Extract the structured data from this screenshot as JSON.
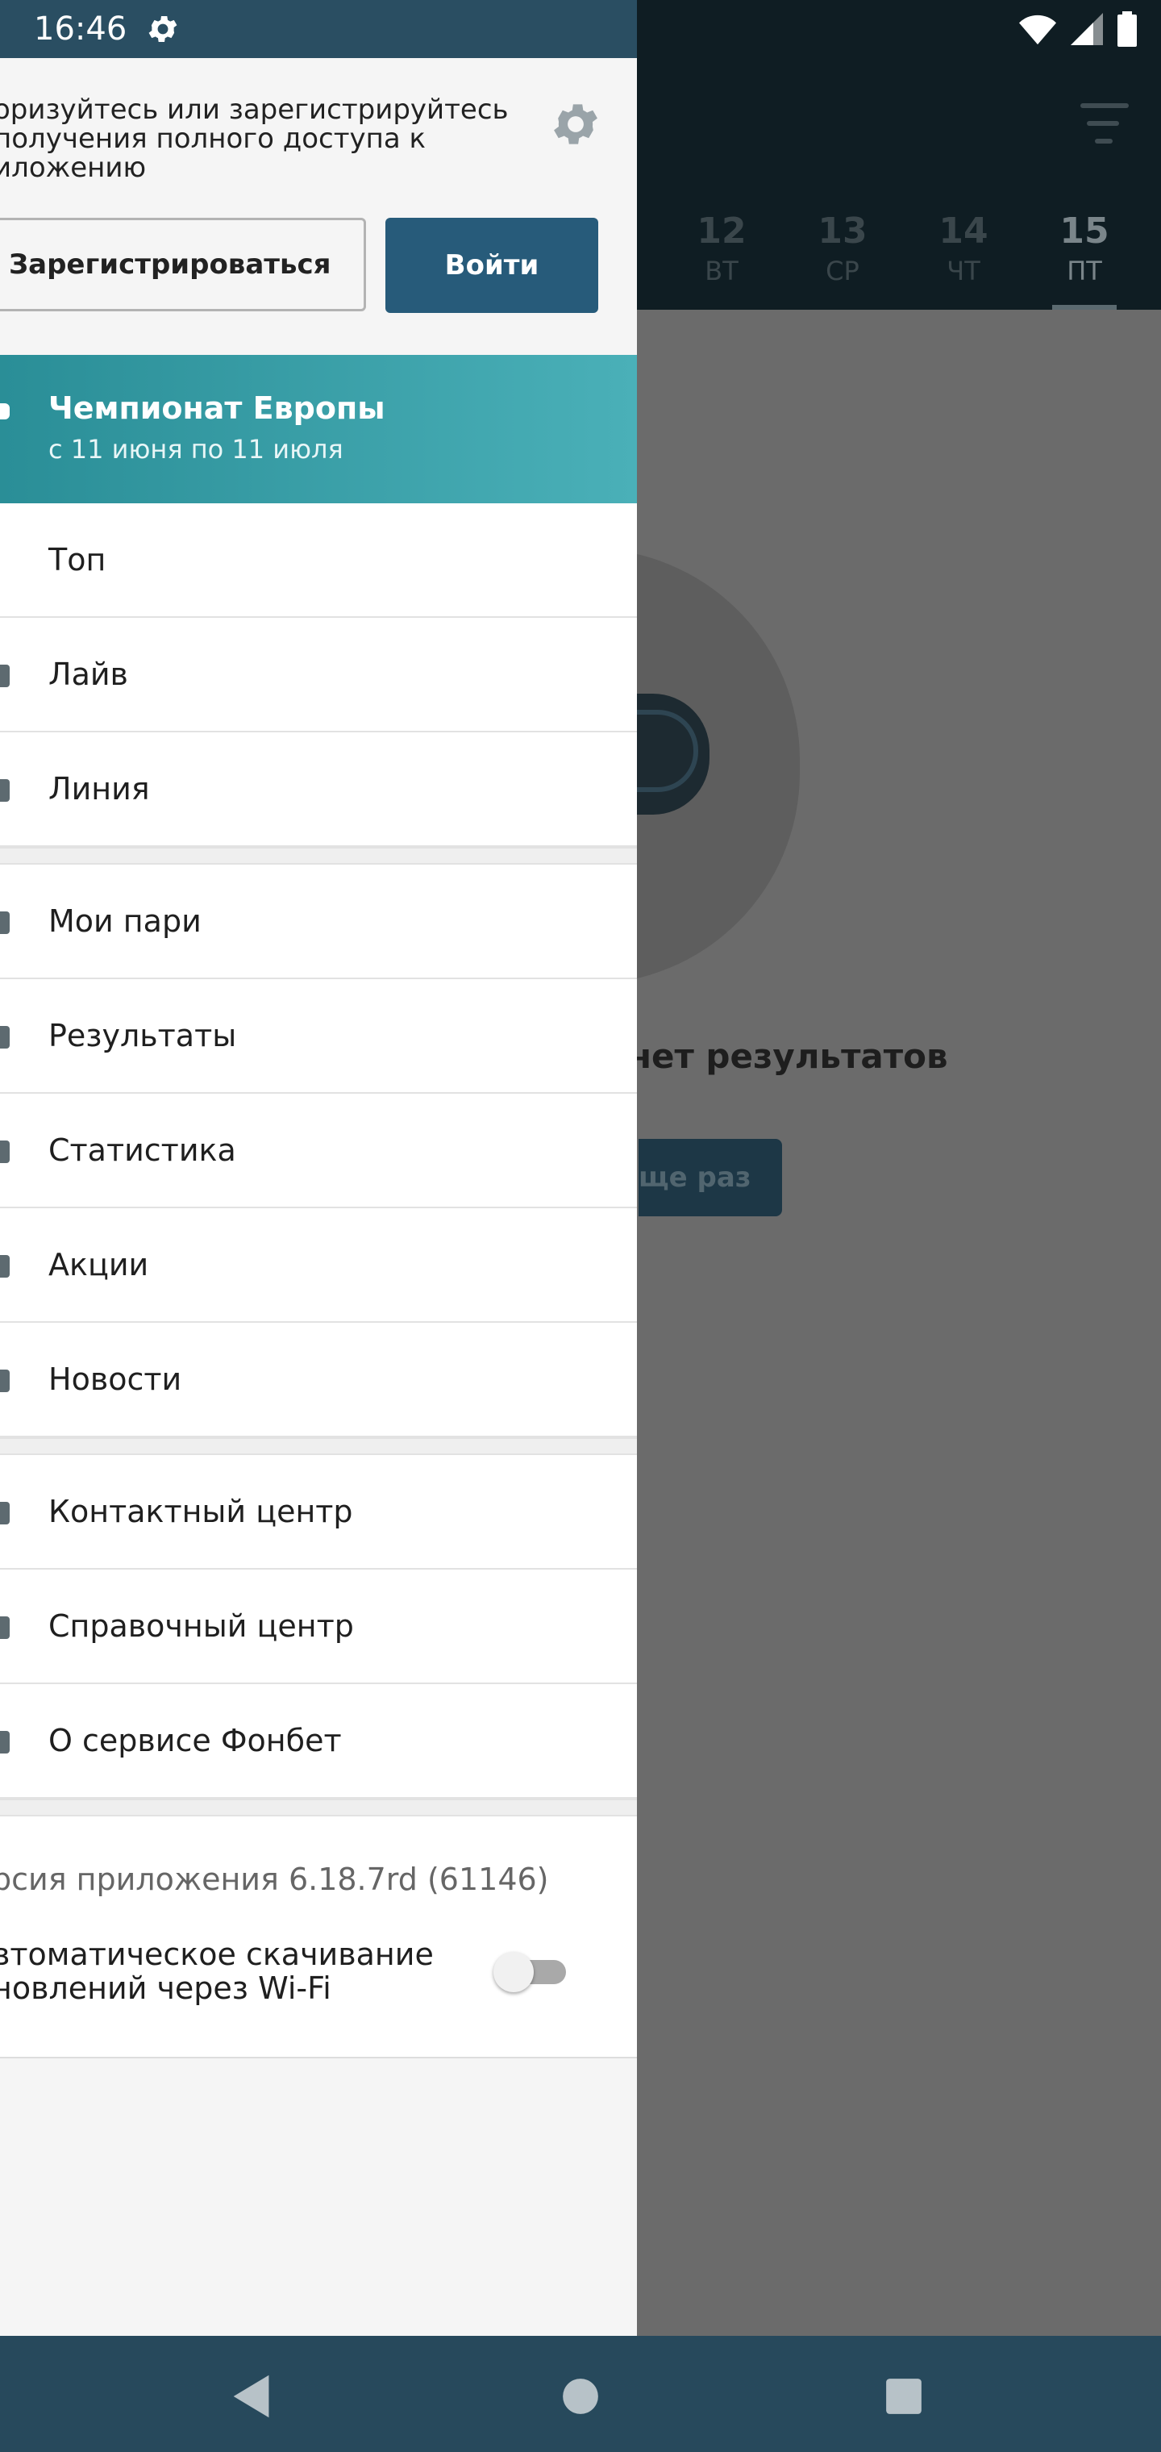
{
  "status_bar": {
    "time": "16:46"
  },
  "background": {
    "dates": [
      {
        "day": "12",
        "dow": "ВТ"
      },
      {
        "day": "13",
        "dow": "СР"
      },
      {
        "day": "14",
        "dow": "ЧТ"
      },
      {
        "day": "15",
        "dow": "ПТ",
        "active": true
      }
    ],
    "no_results_text": "т нет результатов",
    "retry_label": "ще раз"
  },
  "drawer": {
    "auth_prompt": "оризуйтесь или зарегистрируйтесь получения полного доступа к иложению",
    "register_label": "Зарегистрироваться",
    "login_label": "Войти",
    "promo": {
      "title": "Чемпионат Европы",
      "subtitle": "с 11 июня по 11 июля"
    },
    "menu_group_1": [
      "Топ",
      "Лайв",
      "Линия"
    ],
    "menu_group_2": [
      "Мои пари",
      "Результаты",
      "Статистика",
      "Акции",
      "Новости"
    ],
    "menu_group_3": [
      "Контактный центр",
      "Справочный центр",
      "О сервисе Фонбет"
    ],
    "version_text": "рсия приложения 6.18.7rd (61146)",
    "auto_update_label": "втоматическое скачивание новлений через Wi-Fi",
    "auto_update_enabled": false
  },
  "colors": {
    "primary": "#275b7a",
    "promo_start": "#2a8e97",
    "promo_end": "#4ab0b8",
    "nav_bar": "#27495c"
  }
}
